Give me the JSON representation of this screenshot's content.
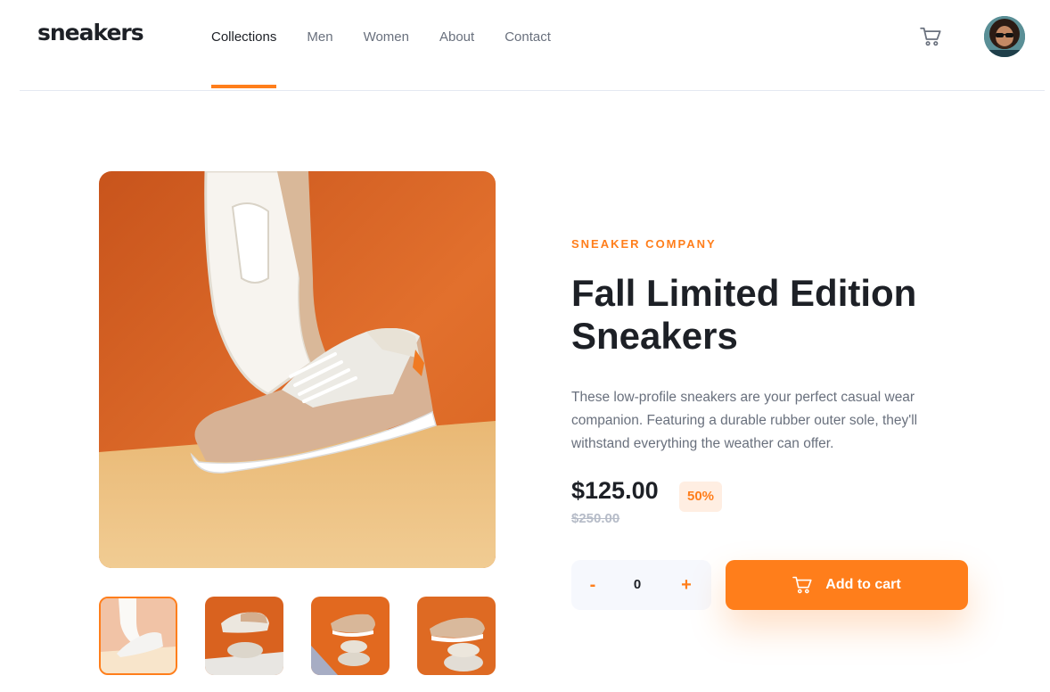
{
  "header": {
    "logo": "sneakers",
    "nav": [
      "Collections",
      "Men",
      "Women",
      "About",
      "Contact"
    ],
    "active_nav": "Collections"
  },
  "icons": {
    "cart": "cart-icon",
    "avatar": "user-avatar",
    "add_to_cart_icon": "cart-icon"
  },
  "colors": {
    "accent": "#ff7e1b",
    "accent_pale": "#ffeee2",
    "text_dark": "#1d2026",
    "text_muted": "#69707d"
  },
  "product": {
    "company": "SNEAKER COMPANY",
    "title": "Fall Limited Edition Sneakers",
    "description": "These low-profile sneakers are your perfect casual wear companion. Featuring a durable rubber outer sole, they'll withstand everything the weather can offer.",
    "price": "$125.00",
    "discount": "50%",
    "original_price": "$250.00",
    "quantity": "0",
    "qty_minus": "-",
    "qty_plus": "+",
    "add_to_cart": "Add to cart"
  },
  "gallery": {
    "thumbnail_count": 4,
    "selected_thumbnail": 1
  }
}
